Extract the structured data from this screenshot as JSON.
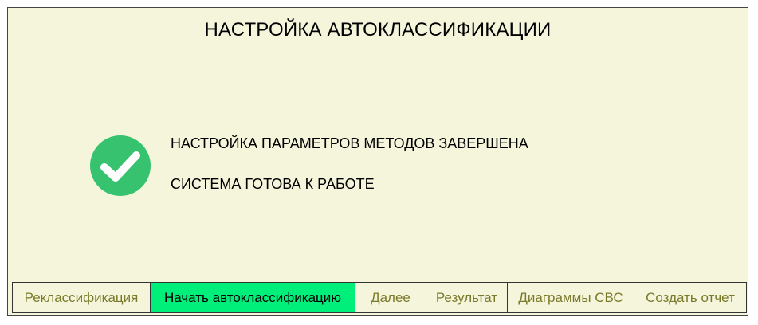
{
  "window": {
    "title": "НАСТРОЙКА АВТОКЛАССИФИКАЦИИ"
  },
  "status": {
    "icon": "check-circle-icon",
    "icon_color": "#36c26f",
    "line1": "НАСТРОЙКА ПАРАМЕТРОВ МЕТОДОВ ЗАВЕРШЕНА",
    "line2": "СИСТЕМА ГОТОВА К РАБОТЕ"
  },
  "toolbar": {
    "active_color": "#00ee7a",
    "buttons": [
      {
        "label": "Реклассификация",
        "active": false
      },
      {
        "label": "Начать автоклассификацию",
        "active": true
      },
      {
        "label": "Далее",
        "active": false
      },
      {
        "label": "Результат",
        "active": false
      },
      {
        "label": "Диаграммы СВС",
        "active": false
      },
      {
        "label": "Создать отчет",
        "active": false
      }
    ]
  }
}
